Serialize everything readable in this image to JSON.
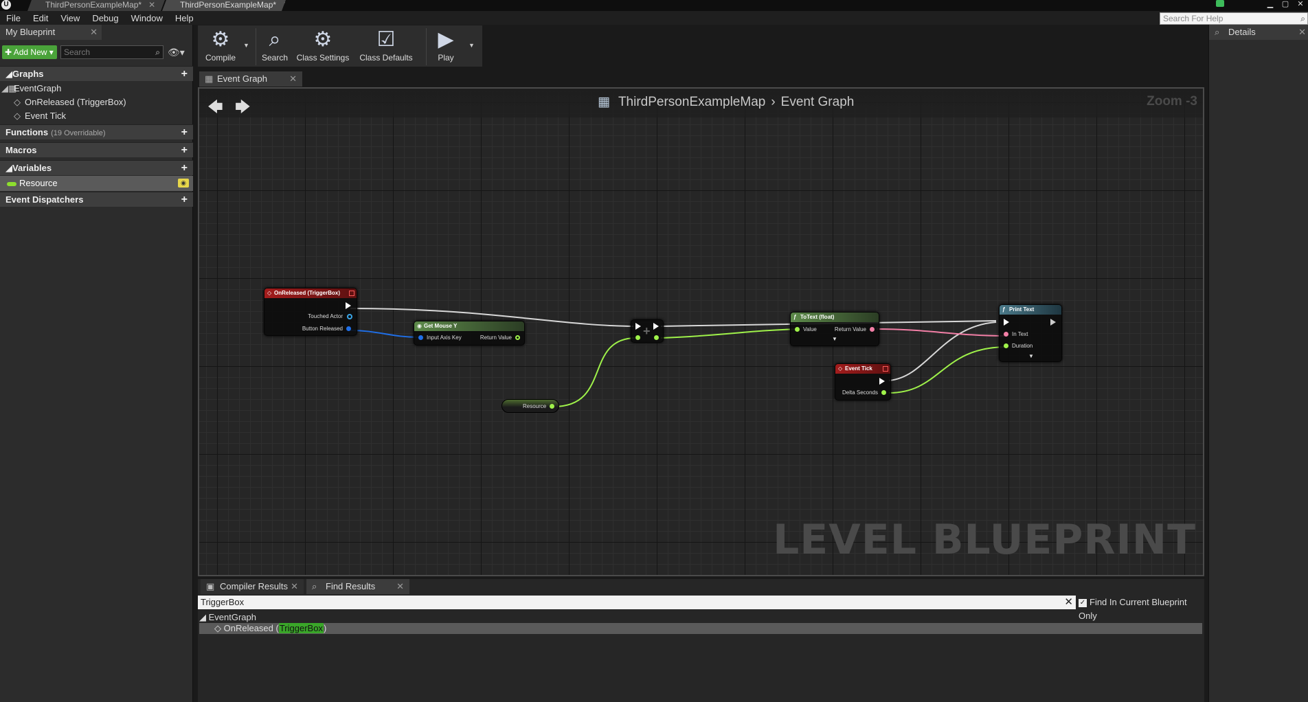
{
  "tabs": [
    {
      "label": "ThirdPersonExampleMap*",
      "active": false
    },
    {
      "label": "ThirdPersonExampleMap*",
      "active": true
    }
  ],
  "logo": "U",
  "menu": [
    "File",
    "Edit",
    "View",
    "Debug",
    "Window",
    "Help"
  ],
  "help_search": {
    "placeholder": "Search For Help"
  },
  "my_blueprint": {
    "tab_label": "My Blueprint",
    "add_new_label": "Add New",
    "search_placeholder": "Search",
    "sections": {
      "graphs": "Graphs",
      "functions": "Functions",
      "functions_sub": "(19 Overridable)",
      "macros": "Macros",
      "variables": "Variables",
      "dispatchers": "Event Dispatchers"
    },
    "graph_items": [
      "EventGraph",
      "OnReleased (TriggerBox)",
      "Event Tick"
    ],
    "variables": [
      "Resource"
    ]
  },
  "toolbar": {
    "compile": "Compile",
    "search": "Search",
    "class_settings": "Class Settings",
    "class_defaults": "Class Defaults",
    "play": "Play"
  },
  "graph_tab": {
    "label": "Event Graph"
  },
  "canvas": {
    "breadcrumb_root": "ThirdPersonExampleMap",
    "breadcrumb_leaf": "Event Graph",
    "zoom": "Zoom -3",
    "watermark": "LEVEL BLUEPRINT"
  },
  "nodes": {
    "on_released": {
      "title": "OnReleased (TriggerBox)",
      "pins": [
        "Touched Actor",
        "Button Released"
      ]
    },
    "get_mouse_y": {
      "title": "Get Mouse Y",
      "pins": [
        "Input Axis Key",
        "Return Value"
      ]
    },
    "to_text": {
      "title": "ToText (float)",
      "pins": [
        "Value",
        "Return Value"
      ]
    },
    "event_tick": {
      "title": "Event Tick",
      "pins": [
        "Delta Seconds"
      ]
    },
    "print_text": {
      "title": "Print Text",
      "pins": [
        "In Text",
        "Duration"
      ]
    },
    "resource": {
      "label": "Resource"
    }
  },
  "bottom": {
    "tab_compiler": "Compiler Results",
    "tab_find": "Find Results",
    "query": "TriggerBox",
    "find_option": "Find In Current Blueprint Only",
    "results_root": "EventGraph",
    "result_prefix": "OnReleased (",
    "result_match": "TriggerBox",
    "result_suffix": ")"
  },
  "details": {
    "tab_label": "Details"
  }
}
